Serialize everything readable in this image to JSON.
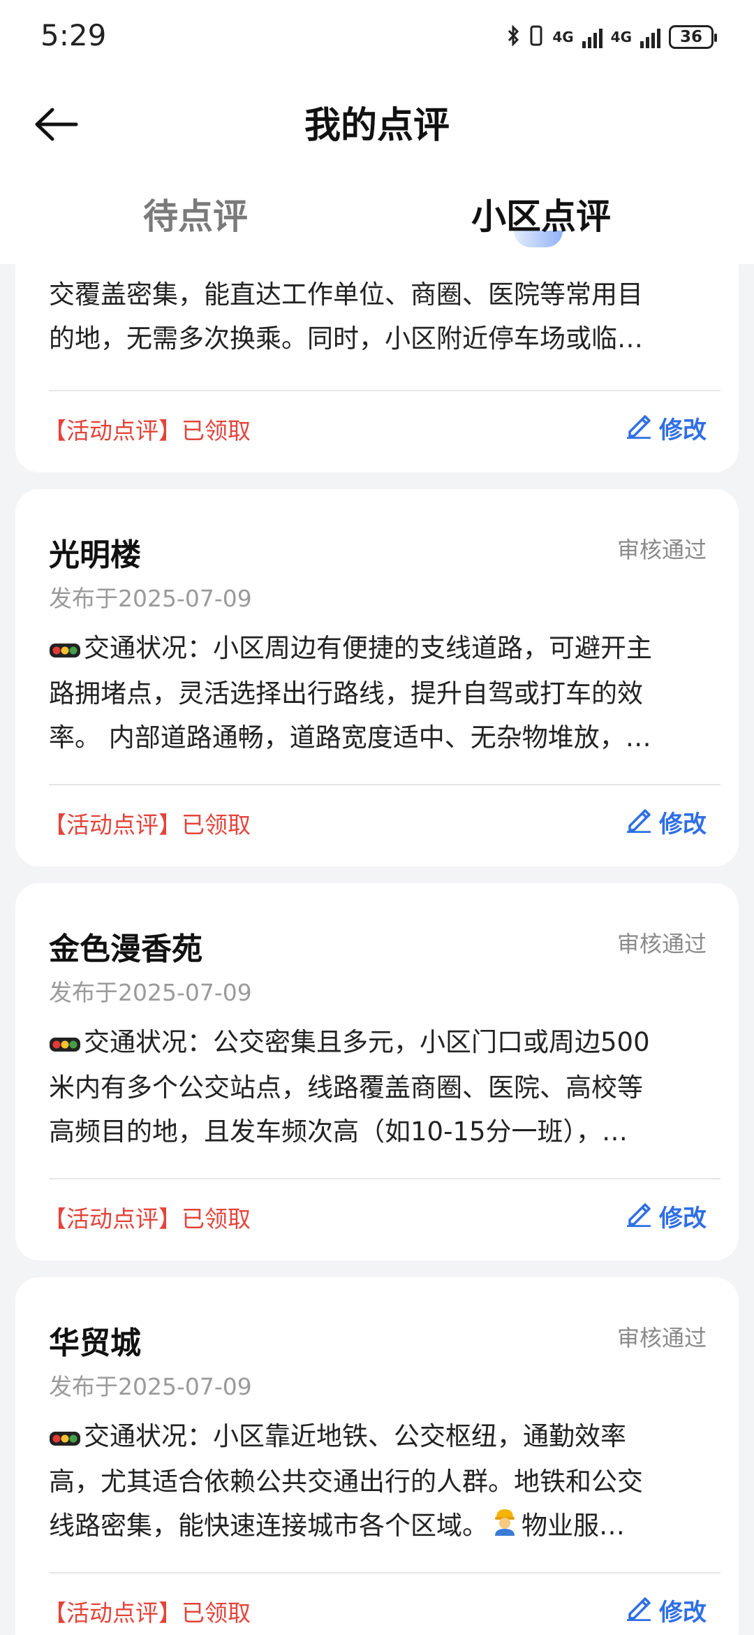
{
  "status_bar": {
    "time": "5:29",
    "net1": "4G",
    "net2": "4G",
    "battery": "36"
  },
  "header": {
    "title": "我的点评",
    "tabs": [
      "待点评",
      "小区点评"
    ],
    "active_tab": "小区点评"
  },
  "partial_card": {
    "lines": [
      "交覆盖密集，能直达工作单位、商圈、医院等常用目",
      "的地，无需多次换乘。同时，小区附近停车场或临…"
    ],
    "activity_label": "【活动点评】已领取",
    "edit_label": "修改"
  },
  "reviews": [
    {
      "name": "光明楼",
      "status": "审核通过",
      "date": "发布于2025-07-09",
      "lines": [
        "交通状况：小区周边有便捷的支线道路，可避开主",
        "路拥堵点，灵活选择出行路线，提升自驾或打车的效",
        "率。 内部道路通畅，道路宽度适中、无杂物堆放，…"
      ],
      "activity_label": "【活动点评】已领取",
      "edit_label": "修改"
    },
    {
      "name": "金色漫香苑",
      "status": "审核通过",
      "date": "发布于2025-07-09",
      "lines": [
        "交通状况：公交密集且多元，小区门口或周边500",
        "米内有多个公交站点，线路覆盖商圈、医院、高校等",
        "高频目的地，且发车频次高（如10-15分一班），…"
      ],
      "activity_label": "【活动点评】已领取",
      "edit_label": "修改"
    },
    {
      "name": "华贸城",
      "status": "审核通过",
      "date": "发布于2025-07-09",
      "lines": [
        "交通状况：小区靠近地铁、公交枢纽，通勤效率",
        "高，尤其适合依赖公共交通出行的人群。地铁和公交",
        "线路密集，能快速连接城市各个区域。",
        "物业服…"
      ],
      "activity_label": "【活动点评】已领取",
      "edit_label": "修改"
    }
  ],
  "icons": {
    "back": "back-arrow-icon",
    "edit": "pencil-icon",
    "traffic": "traffic-light-icon",
    "worker": "worker-emoji-icon"
  },
  "colors": {
    "accent": "#2f6fe6",
    "activity": "#e4433a",
    "status": "#8a8a8a",
    "background": "#f3f4f6"
  }
}
